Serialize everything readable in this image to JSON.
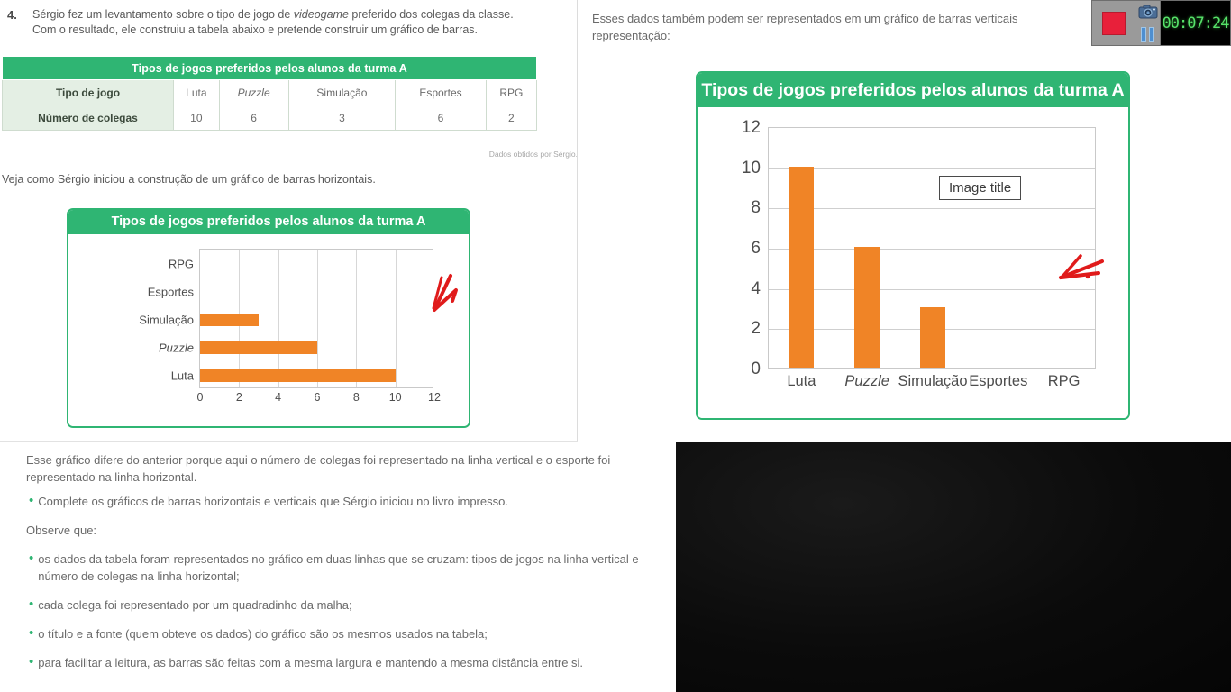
{
  "question": {
    "number": "4.",
    "line1_a": "Sérgio fez um levantamento sobre o tipo de jogo de ",
    "line1_em": "videogame",
    "line1_b": " preferido dos colegas da classe.",
    "line2": "Com o resultado, ele construiu a tabela abaixo e pretende construir um gráfico de barras."
  },
  "table": {
    "title": "Tipos de jogos preferidos pelos alunos da turma A",
    "row1_label": "Tipo de jogo",
    "row2_label": "Número de colegas",
    "categories": [
      "Luta",
      "Puzzle",
      "Simulação",
      "Esportes",
      "RPG"
    ],
    "values": [
      "10",
      "6",
      "3",
      "6",
      "2"
    ],
    "source": "Dados obtidos por Sérgio."
  },
  "veja_text": "Veja como Sérgio iniciou a construção de um gráfico de barras horizontais.",
  "right_intro": {
    "line1": "Esses dados também podem ser representados em um gráfico de barras verticais",
    "line2": "representação:"
  },
  "tooltip": {
    "label": "Image title"
  },
  "chart_data": [
    {
      "type": "bar",
      "orientation": "horizontal",
      "title": "Tipos de jogos preferidos pelos alunos da turma A",
      "categories": [
        "Luta",
        "Puzzle",
        "Simulação",
        "Esportes",
        "RPG"
      ],
      "values": [
        10,
        6,
        3,
        0,
        0
      ],
      "xlabel": "",
      "ylabel": "",
      "xlim": [
        0,
        12
      ],
      "xticks": [
        "0",
        "2",
        "4",
        "6",
        "8",
        "10",
        "12"
      ],
      "grid": true,
      "legend": "none",
      "bar_color": "#f08426",
      "note": "Esportes e RPG ainda não desenhados (gráfico incompleto)"
    },
    {
      "type": "bar",
      "orientation": "vertical",
      "title": "Tipos de jogos preferidos pelos alunos da turma A",
      "categories": [
        "Luta",
        "Puzzle",
        "Simulação",
        "Esportes",
        "RPG"
      ],
      "values": [
        10,
        6,
        3,
        0,
        0
      ],
      "xlabel": "",
      "ylabel": "",
      "ylim": [
        0,
        12
      ],
      "yticks": [
        "0",
        "2",
        "4",
        "6",
        "8",
        "10",
        "12"
      ],
      "grid": true,
      "legend": "none",
      "bar_color": "#f08426",
      "annotation": "Image title",
      "note": "Esportes e RPG ainda não desenhados (gráfico incompleto)"
    }
  ],
  "bottom": {
    "para1": "Esse gráfico difere do anterior porque aqui o número de colegas foi representado na linha vertical e o esporte foi representado na linha horizontal.",
    "bullet1": "Complete os gráficos de barras horizontais e verticais que Sérgio iniciou no livro impresso.",
    "observe": "Observe que:",
    "bullet2": "os dados da tabela foram representados no gráfico em duas linhas que se cruzam: tipos de jogos na linha vertical e número de colegas na linha horizontal;",
    "bullet3": "cada colega foi representado por um quadradinho da malha;",
    "bullet4": "o título e a fonte (quem obteve os dados) do gráfico são os mesmos usados na tabela;",
    "bullet5": "para facilitar a leitura, as barras são feitas com a mesma largura e mantendo a mesma distância entre si."
  },
  "recorder": {
    "timer": "00:07:24",
    "stop_label": "",
    "camera_label": "",
    "pause_label": ""
  },
  "colors": {
    "brand_green": "#2fb573",
    "bar_orange": "#f08426",
    "record_red": "#e8203a",
    "timer_green": "#57e36a"
  }
}
